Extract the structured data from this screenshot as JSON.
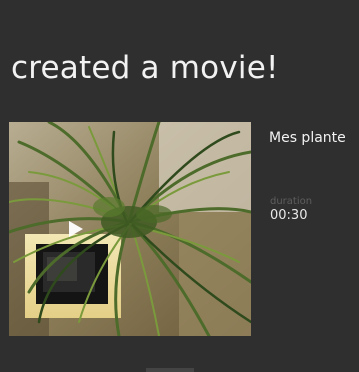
{
  "header": {
    "title": "created a movie!"
  },
  "movie": {
    "name": "Mes plante",
    "duration_label": "duration",
    "duration_value": "00:30",
    "thumbnail_icon": "play-icon"
  },
  "colors": {
    "background": "#2f2f2f",
    "text": "#f2f2f2",
    "muted_label": "#5e5e5e"
  }
}
